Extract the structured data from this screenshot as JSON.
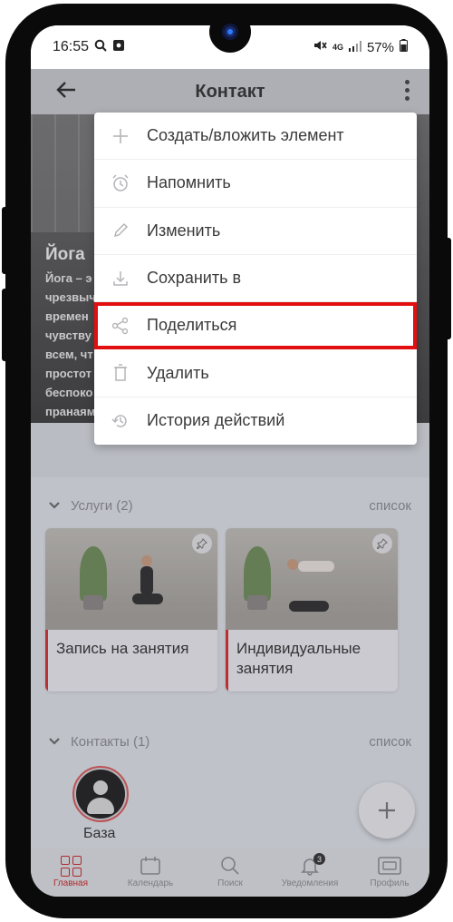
{
  "status_bar": {
    "time": "16:55",
    "left_icons": [
      "search-icon",
      "image-icon"
    ],
    "network": "4G",
    "battery": "57%"
  },
  "app_bar": {
    "title": "Контакт",
    "back_icon": "arrow-left-icon",
    "more_icon": "more-vertical-icon"
  },
  "hero": {
    "title": "Йога",
    "description_lines": [
      "Йога – э",
      "чрезвыч",
      "времен",
      "чувству",
      "всем, чт",
      "простот",
      "беспоко",
      "пранаям"
    ]
  },
  "menu": {
    "items": [
      {
        "label": "Создать/вложить элемент",
        "icon": "plus-icon"
      },
      {
        "label": "Напомнить",
        "icon": "alarm-icon"
      },
      {
        "label": "Изменить",
        "icon": "pencil-icon"
      },
      {
        "label": "Сохранить в",
        "icon": "download-icon"
      },
      {
        "label": "Поделиться",
        "icon": "share-icon"
      },
      {
        "label": "Удалить",
        "icon": "trash-icon"
      },
      {
        "label": "История действий",
        "icon": "history-icon"
      }
    ],
    "highlighted_index": 4,
    "highlight_color": "#e10f0f"
  },
  "services": {
    "title": "Услуги (2)",
    "link": "список",
    "cards": [
      {
        "title": "Запись на занятия"
      },
      {
        "title": "Индивидуальные занятия"
      }
    ]
  },
  "contacts": {
    "title": "Контакты (1)",
    "link": "список",
    "items": [
      {
        "name": "База"
      }
    ]
  },
  "fab": {
    "icon": "plus-icon"
  },
  "bottom_nav": {
    "items": [
      {
        "label": "Главная",
        "icon": "grid-icon",
        "active": true
      },
      {
        "label": "Календарь",
        "icon": "calendar-icon"
      },
      {
        "label": "Поиск",
        "icon": "search-icon"
      },
      {
        "label": "Уведомления",
        "icon": "bell-icon",
        "badge": "3"
      },
      {
        "label": "Профиль",
        "icon": "profile-card-icon"
      }
    ]
  },
  "colors": {
    "accent": "#c62828"
  }
}
